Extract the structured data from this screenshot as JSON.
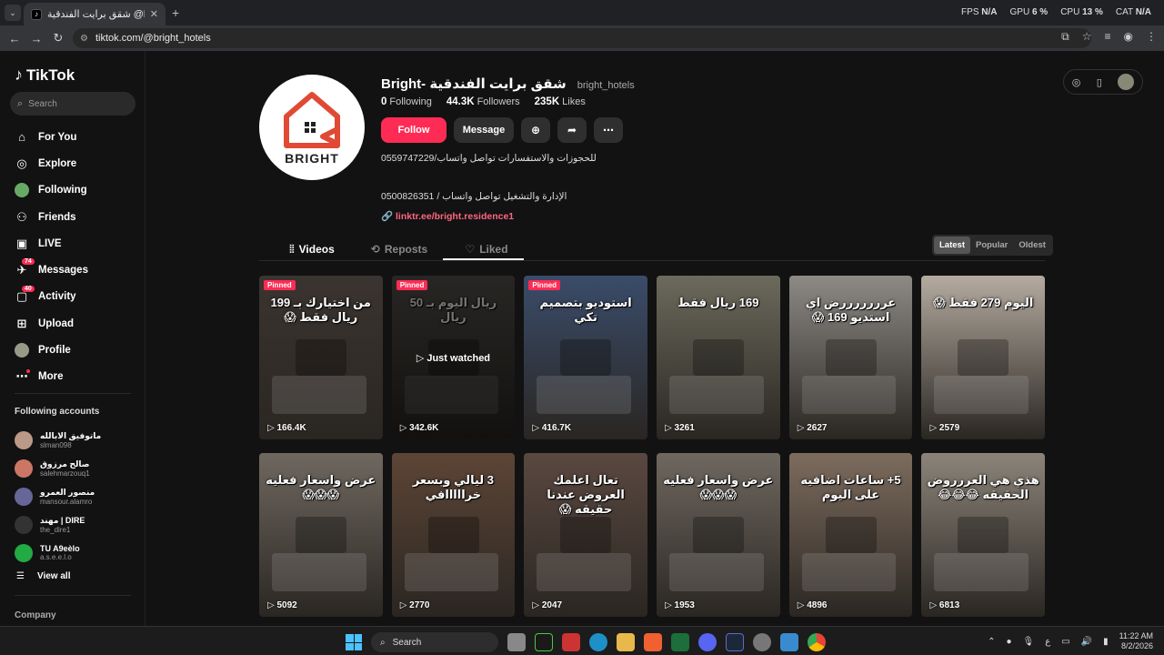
{
  "browser": {
    "tab_title": "شقق برايت الفندقية @bri",
    "url": "tiktok.com/@bright_hotels",
    "perf": {
      "fps_label": "FPS",
      "fps": "N/A",
      "gpu_label": "GPU",
      "gpu": "6 %",
      "cpu_label": "CPU",
      "cpu": "13 %",
      "cat_label": "CAT",
      "cat": "N/A"
    }
  },
  "sidebar": {
    "logo": "TikTok",
    "search_placeholder": "Search",
    "nav": [
      {
        "label": "For You",
        "icon": "home-icon"
      },
      {
        "label": "Explore",
        "icon": "compass-icon"
      },
      {
        "label": "Following",
        "icon": "following-avatar-icon"
      },
      {
        "label": "Friends",
        "icon": "friends-icon"
      },
      {
        "label": "LIVE",
        "icon": "live-icon"
      },
      {
        "label": "Messages",
        "icon": "messages-icon",
        "badge": "74"
      },
      {
        "label": "Activity",
        "icon": "activity-icon",
        "badge": "40"
      },
      {
        "label": "Upload",
        "icon": "upload-icon"
      },
      {
        "label": "Profile",
        "icon": "profile-avatar-icon"
      },
      {
        "label": "More",
        "icon": "more-icon"
      }
    ],
    "following_title": "Following accounts",
    "accounts": [
      {
        "name": "ماتوفيق الابالله",
        "handle": "slman098",
        "color": "#b98"
      },
      {
        "name": "صالح مرزوق",
        "handle": "salehmarzouq1",
        "color": "#c76"
      },
      {
        "name": "منصور العمرو",
        "handle": "mansour.alamro",
        "color": "#669"
      },
      {
        "name": "مهند | DIRE",
        "handle": "the_dire1",
        "color": "#333"
      },
      {
        "name": "TU A9eèlo",
        "handle": "a.s.e.e.l.o",
        "color": "#2a4"
      }
    ],
    "view_all": "View all",
    "company": "Company"
  },
  "profile": {
    "avatar_text": "BRIGHT",
    "display_name": "Bright- شقق برايت الفندقية",
    "username": "bright_hotels",
    "following_count": "0",
    "following_label": "Following",
    "followers_count": "44.3K",
    "followers_label": "Followers",
    "likes_count": "235K",
    "likes_label": "Likes",
    "follow_label": "Follow",
    "message_label": "Message",
    "bio_line1": "0559747229/للحجوزات والاستفسارات تواصل واتساب",
    "bio_line2": "0500826351 / الإدارة والتشغيل تواصل واتساب",
    "link": "linktr.ee/bright.residence1"
  },
  "tabs": {
    "videos": "Videos",
    "reposts": "Reposts",
    "liked": "Liked"
  },
  "sort": {
    "latest": "Latest",
    "popular": "Popular",
    "oldest": "Oldest"
  },
  "videos": [
    {
      "views": "166.4K",
      "pinned": "Pinned",
      "text": "من اختيارك بـ 199 ريال فقط 😱",
      "bg": "#3b3430"
    },
    {
      "views": "342.6K",
      "pinned": "Pinned",
      "text": "ريال اليوم بـ 50 ريال",
      "watched": "Just watched",
      "bg": "#5a5550"
    },
    {
      "views": "416.7K",
      "pinned": "Pinned",
      "text": "استوديو بتصميم تكي",
      "bg": "#3a4c6a"
    },
    {
      "views": "3261",
      "pinned": "",
      "text": "169 ريال فقط",
      "bg": "#6b6a5c"
    },
    {
      "views": "2627",
      "pinned": "",
      "text": "عرررررررض اي استديو 169 😱",
      "bg": "#8d8a86"
    },
    {
      "views": "2579",
      "pinned": "",
      "text": "اليوم 279 فقط 😱",
      "bg": "#b4aba0"
    },
    {
      "views": "5092",
      "pinned": "",
      "text": "عرض واسعار فعليه 😱😱😱",
      "bg": "#6f6860"
    },
    {
      "views": "2770",
      "pinned": "",
      "text": "3 ليالي وبسعر خرااااافي",
      "bg": "#5d4536"
    },
    {
      "views": "2047",
      "pinned": "",
      "text": "تعال اعلمك العروض عندنا حقيقه 😱",
      "bg": "#5a4840"
    },
    {
      "views": "1953",
      "pinned": "",
      "text": "عرض واسعار فعليه 😱😱😱",
      "bg": "#6f6860"
    },
    {
      "views": "4896",
      "pinned": "",
      "text": "5+ ساعات اضافيه على اليوم",
      "bg": "#7d6c5e"
    },
    {
      "views": "6813",
      "pinned": "",
      "text": "هذي هي العررروض الحقيقه 😂😂😂",
      "bg": "#8c847a"
    }
  ],
  "taskbar": {
    "search": "Search",
    "time": "11:22 AM",
    "date": "8/2/2026"
  }
}
